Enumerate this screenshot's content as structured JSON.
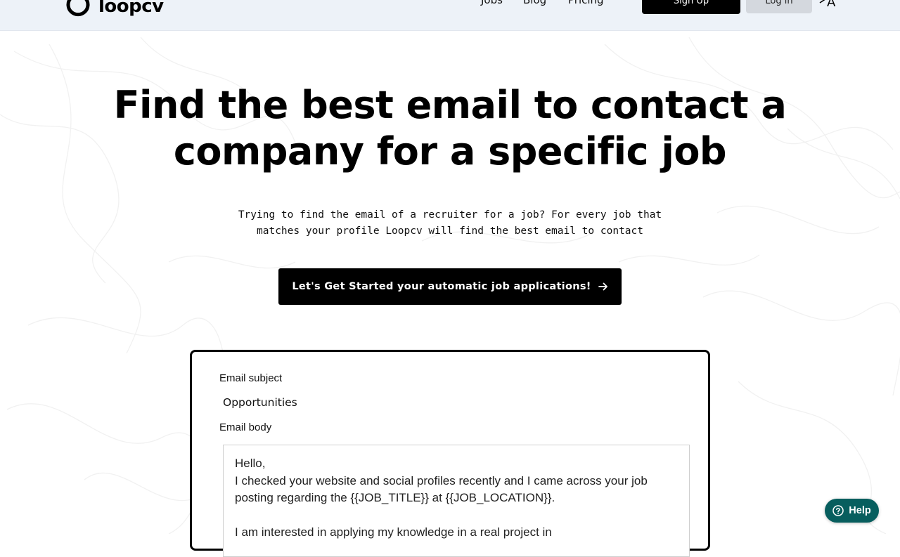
{
  "header": {
    "logo_text": "loopcv",
    "nav": [
      "Jobs",
      "Blog",
      "Pricing"
    ],
    "signup_label": "Sign Up",
    "login_label": "Log in",
    "language": "A"
  },
  "hero": {
    "title": "Find the best email to contact a company for a specific job",
    "subtitle": "Trying to find the email of a recruiter for a job? For every job that matches your profile Loopcv will find the best email to contact",
    "cta_label": "Let's Get Started your automatic job applications!"
  },
  "email_card": {
    "subject_label": "Email subject",
    "subject_value": "Opportunities",
    "body_label": "Email body",
    "body_lines": [
      "Hello,",
      "I checked your website and social profiles recently and I came across your job posting regarding the {{JOB_TITLE}} at {{JOB_LOCATION}}.",
      "",
      "I am interested in applying my knowledge in a real project in"
    ]
  },
  "help": {
    "label": "Help"
  },
  "colors": {
    "header_bg": "#edf2f8",
    "help_bg": "#075e5e",
    "cta_bg": "#000000"
  }
}
